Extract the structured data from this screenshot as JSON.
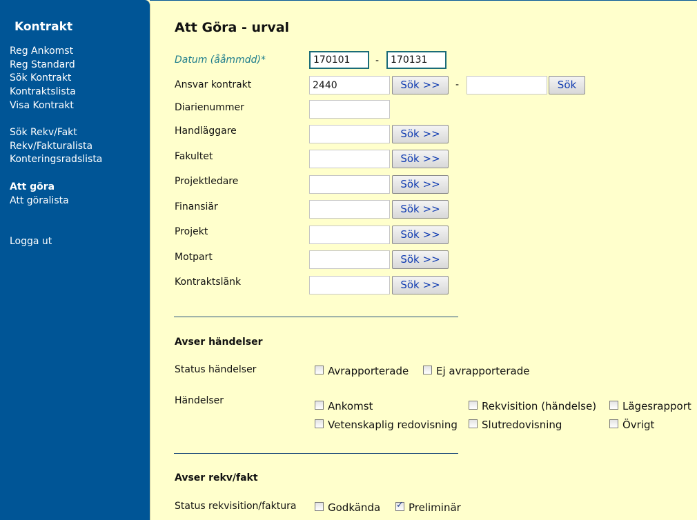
{
  "sidebar": {
    "title": "Kontrakt",
    "group1": [
      "Reg Ankomst",
      "Reg Standard",
      "Sök Kontrakt",
      "Kontraktslista",
      "Visa Kontrakt"
    ],
    "group2": [
      "Sök Rekv/Fakt",
      "Rekv/Fakturalista",
      "Konteringsradslista"
    ],
    "group3_header": "Att göra",
    "group3": [
      "Att göralista"
    ],
    "logout": "Logga ut"
  },
  "page": {
    "title": "Att Göra - urval"
  },
  "form": {
    "datum_label": "Datum (ååmmdd)*",
    "datum_from": "170101",
    "datum_sep": "-",
    "datum_to": "170131",
    "ansvar_label": "Ansvar kontrakt",
    "ansvar_value": "2440",
    "ansvar_sep": "-",
    "ansvar_to": "",
    "diarie_label": "Diarienummer",
    "sok_more": "Sök >>",
    "sok": "Sök",
    "rows": [
      {
        "label": "Handläggare"
      },
      {
        "label": "Fakultet"
      },
      {
        "label": "Projektledare"
      },
      {
        "label": "Finansiär"
      },
      {
        "label": "Projekt"
      },
      {
        "label": "Motpart"
      },
      {
        "label": "Kontraktslänk"
      }
    ]
  },
  "handelser": {
    "section_title": "Avser händelser",
    "status_label": "Status händelser",
    "status_options": [
      {
        "label": "Avrapporterade",
        "checked": false
      },
      {
        "label": "Ej avrapporterade",
        "checked": false
      }
    ],
    "handelser_label": "Händelser",
    "options": [
      {
        "label": "Ankomst",
        "checked": false
      },
      {
        "label": "Rekvisition (händelse)",
        "checked": false
      },
      {
        "label": "Lägesrapport",
        "checked": false
      },
      {
        "label": "Vetenskaplig redovisning",
        "checked": false
      },
      {
        "label": "Slutredovisning",
        "checked": false
      },
      {
        "label": "Övrigt",
        "checked": false
      }
    ]
  },
  "rekvfakt": {
    "section_title": "Avser rekv/fakt",
    "status_label": "Status rekvisition/faktura",
    "options": [
      {
        "label": "Godkända",
        "checked": false
      },
      {
        "label": "Preliminär",
        "checked": true
      }
    ]
  }
}
